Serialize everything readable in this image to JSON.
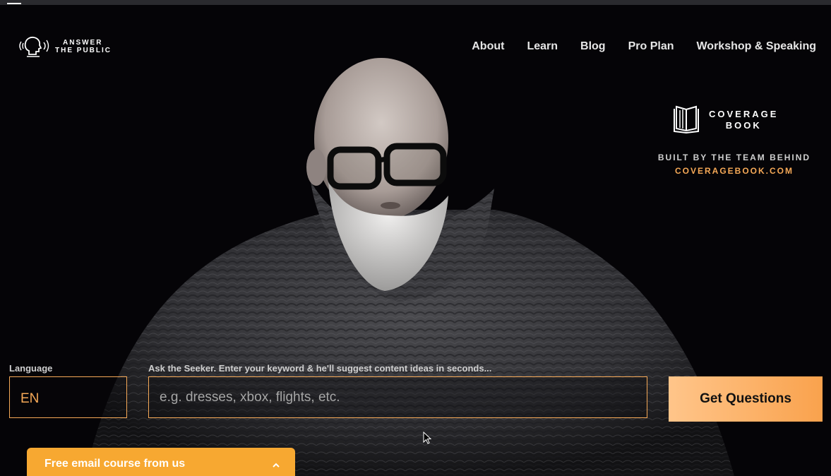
{
  "logo": {
    "line1": "ANSWER",
    "line2": "THE PUBLIC",
    "icon": "speaking-head-icon"
  },
  "nav": [
    {
      "label": "About"
    },
    {
      "label": "Learn"
    },
    {
      "label": "Blog"
    },
    {
      "label": "Pro Plan"
    },
    {
      "label": "Workshop & Speaking"
    }
  ],
  "coverage": {
    "name_line1": "COVERAGE",
    "name_line2": "BOOK",
    "icon": "open-book-icon",
    "built_by": "BUILT BY THE TEAM BEHIND",
    "link": "COVERAGEBOOK.COM",
    "link_color": "#f6a957"
  },
  "search": {
    "language_label": "Language",
    "language_value": "EN",
    "keyword_label": "Ask the Seeker. Enter your keyword & he'll suggest content ideas in seconds...",
    "keyword_placeholder": "e.g. dresses, xbox, flights, etc.",
    "button_label": "Get Questions",
    "accent": "#f6a957"
  },
  "email_course": {
    "label": "Free email course from us",
    "icon": "chevron-up-icon",
    "color": "#f7a831"
  }
}
